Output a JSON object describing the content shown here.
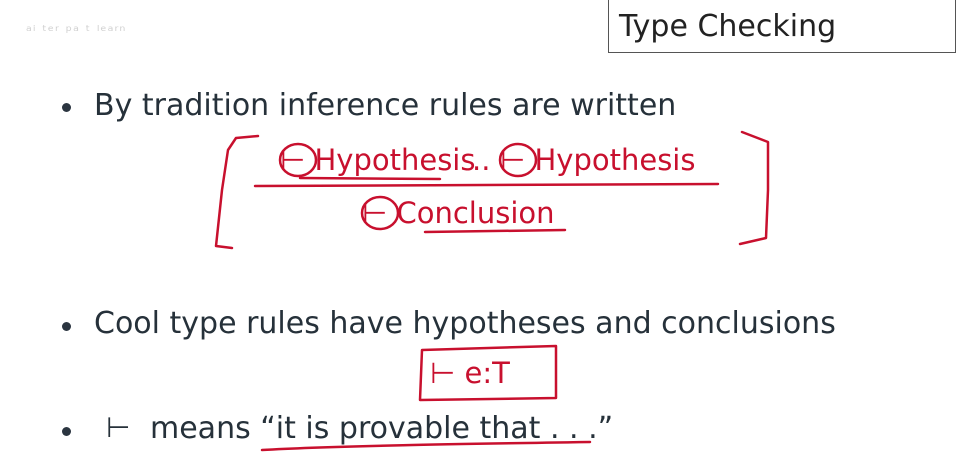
{
  "watermark": "ᵃⁱ ᵗᵉʳ ᵖᵃ ᵗ ˡᵉᵃʳⁿ",
  "slide": {
    "title": "Type Checking",
    "bullets": [
      {
        "text": "By tradition inference rules are written"
      },
      {
        "text": "Cool type rules have hypotheses and conclusions"
      },
      {
        "prefix": "⊢",
        "text": "means “it is provable that . . .”"
      }
    ]
  },
  "annotations": {
    "hyp1": "⊢ Hypothesis",
    "dots": "..",
    "hyp2": "⊢ Hypothesis",
    "conclusion": "⊢ Conclusion",
    "judgment": "⊢ e:T"
  },
  "colors": {
    "ink": "#c8102e",
    "text": "#26313a"
  }
}
